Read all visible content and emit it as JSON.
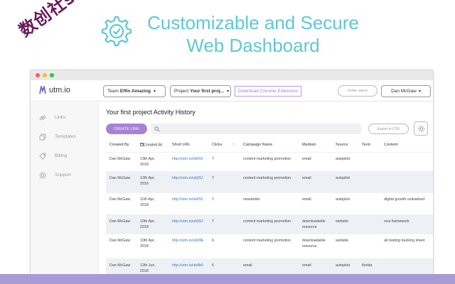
{
  "hero": {
    "title_line1": "Customizable and Secure",
    "title_line2": "Web Dashboard",
    "watermark": "数创社scs66"
  },
  "colors": {
    "accent": "#a682d7",
    "hero": "#5fc8d3",
    "link": "#3578c5",
    "band": "#a79bd6"
  },
  "topbar": {
    "logo_text": "utm.io",
    "team_label": "Team",
    "team_value": "Effin Amazing",
    "project_label": "Project",
    "project_value": "Your first proj...",
    "extension_button": "Download Chrome Extension",
    "invite_button": "invite users",
    "user_name": "Dan McGaw"
  },
  "sidebar": {
    "items": [
      {
        "label": "Links",
        "icon": "link-icon"
      },
      {
        "label": "Templates",
        "icon": "templates-icon"
      },
      {
        "label": "Billing",
        "icon": "tag-icon"
      },
      {
        "label": "Support",
        "icon": "lifebuoy-icon"
      }
    ]
  },
  "main": {
    "title": "Your first project Activity History",
    "create_button": "CREATE LINK",
    "export_button": "Export to CSV",
    "columns": [
      "Created By",
      "Created At",
      "Short URL",
      "Clicks",
      "Campaign Name",
      "Medium",
      "Source",
      "Term",
      "Content"
    ],
    "rows": [
      {
        "created_by": "Dan McGaw",
        "created_at_1": "13th Apr,",
        "created_at_2": "2018",
        "short_url": "http://utm.io/ub09J",
        "clicks": "7",
        "campaign": "content marketing promotion",
        "medium_1": "email",
        "medium_2": "",
        "source": "autopilot",
        "term": "",
        "content": ""
      },
      {
        "created_by": "Dan McGaw",
        "created_at_1": "12th Apr,",
        "created_at_2": "2018",
        "short_url": "http://utm.io/ub09J",
        "clicks": "7",
        "campaign": "content marketing promotion",
        "medium_1": "email",
        "medium_2": "",
        "source": "autopilot",
        "term": "",
        "content": ""
      },
      {
        "created_by": "Dan McGaw",
        "created_at_1": "11th Apr,",
        "created_at_2": "2018",
        "short_url": "http://utm.io/ub09J",
        "clicks": "7",
        "campaign": "newsletter",
        "medium_1": "email",
        "medium_2": "",
        "source": "autopilot",
        "term": "",
        "content": "digital growth unleashed"
      },
      {
        "created_by": "Dan McGaw",
        "created_at_1": "10th Apr,",
        "created_at_2": "2018",
        "short_url": "http://utm.io/ub09J",
        "clicks": "7",
        "campaign": "content marketing promotion",
        "medium_1": "downloadable",
        "medium_2": "resource",
        "source": "website",
        "term": "",
        "content": "vice framework"
      },
      {
        "created_by": "Dan McGaw",
        "created_at_1": "10th Apr,",
        "created_at_2": "2018",
        "short_url": "http://utm.io/ub09E",
        "clicks": "6",
        "campaign": "content marketing promotion",
        "medium_1": "downloadable",
        "medium_2": "resource",
        "source": "website",
        "term": "",
        "content": "ab testing tracking sheet"
      },
      {
        "created_by": "Dan McGaw",
        "created_at_1": "12th Jun,",
        "created_at_2": "2018",
        "short_url": "http://utm.io/ub4b0",
        "clicks": "6",
        "campaign": "email",
        "medium_1": "email",
        "medium_2": "",
        "source": "autopilot",
        "term": "florida",
        "content": ""
      }
    ]
  }
}
